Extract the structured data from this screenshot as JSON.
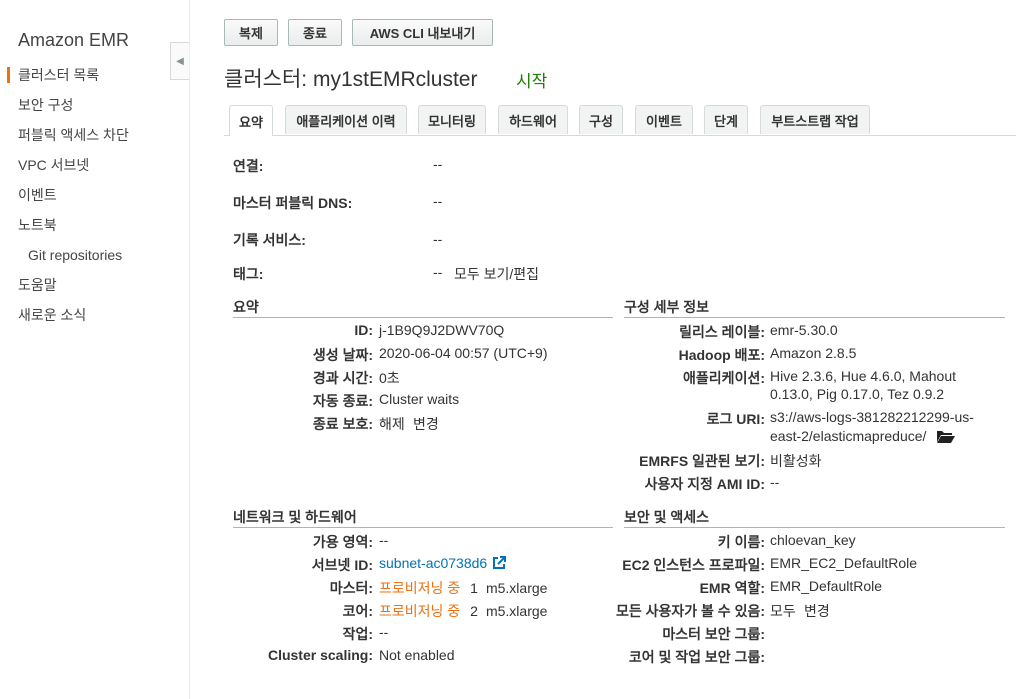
{
  "sidebar": {
    "title": "Amazon EMR",
    "items": [
      {
        "label": "클러스터 목록"
      },
      {
        "label": "보안 구성"
      },
      {
        "label": "퍼블릭 액세스 차단"
      },
      {
        "label": "VPC 서브넷"
      },
      {
        "label": "이벤트"
      },
      {
        "label": "노트북"
      },
      {
        "label": "Git repositories"
      },
      {
        "label": "도움말"
      },
      {
        "label": "새로운 소식"
      }
    ]
  },
  "toolbar": {
    "clone_label": "복제",
    "terminate_label": "종료",
    "cli_export_label": "AWS CLI 내보내기"
  },
  "header": {
    "title": "클러스터: my1stEMRcluster",
    "status": "시작"
  },
  "tabs": [
    "요약",
    "애플리케이션 이력",
    "모니터링",
    "하드웨어",
    "구성",
    "이벤트",
    "단계",
    "부트스트랩 작업"
  ],
  "connections": {
    "connect_label": "연결:",
    "connect_value": "--",
    "dns_label": "마스터 퍼블릭 DNS:",
    "dns_value": "--",
    "logging_label": "기록 서비스:",
    "logging_value": "--",
    "tags_label": "태그:",
    "tags_value": "--",
    "tags_link": "모두 보기/편집"
  },
  "summary": {
    "heading": "요약",
    "id_label": "ID:",
    "id_value": "j-1B9Q9J2DWV70Q",
    "created_label": "생성 날짜:",
    "created_value": "2020-06-04 00:57 (UTC+9)",
    "elapsed_label": "경과 시간:",
    "elapsed_value": "0초",
    "auto_term_label": "자동 종료:",
    "auto_term_value": "Cluster waits",
    "term_protect_label": "종료 보호:",
    "term_protect_value": "해제",
    "term_protect_link": "변경"
  },
  "config": {
    "heading": "구성 세부 정보",
    "release_label": "릴리스 레이블:",
    "release_value": "emr-5.30.0",
    "hadoop_label": "Hadoop 배포:",
    "hadoop_value": "Amazon 2.8.5",
    "apps_label": "애플리케이션:",
    "apps_value_1": "Hive 2.3.6, Hue 4.6.0, Mahout",
    "apps_value_2": "0.13.0, Pig 0.17.0, Tez 0.9.2",
    "log_label": "로그 URI:",
    "log_value_1": "s3://aws-logs-381282212299-us-",
    "log_value_2": "east-2/elasticmapreduce/",
    "emrfs_label": "EMRFS 일관된 보기:",
    "emrfs_value": "비활성화",
    "ami_label": "사용자 지정 AMI ID:",
    "ami_value": "--"
  },
  "network": {
    "heading": "네트워크 및 하드웨어",
    "az_label": "가용 영역:",
    "az_value": "--",
    "subnet_label": "서브넷 ID:",
    "subnet_value": "subnet-ac0738d6",
    "master_label": "마스터:",
    "master_status": "프로비저닝 중",
    "master_count": "1",
    "master_type": "m5.xlarge",
    "core_label": "코어:",
    "core_status": "프로비저닝 중",
    "core_count": "2",
    "core_type": "m5.xlarge",
    "task_label": "작업:",
    "task_value": "--",
    "scaling_label": "Cluster scaling:",
    "scaling_value": "Not enabled"
  },
  "security": {
    "heading": "보안 및 액세스",
    "key_label": "키 이름:",
    "key_value": "chloevan_key",
    "profile_label": "EC2 인스턴스 프로파일:",
    "profile_value": "EMR_EC2_DefaultRole",
    "role_label": "EMR 역할:",
    "role_value": "EMR_DefaultRole",
    "visible_label": "모든 사용자가 볼 수 있음:",
    "visible_value": "모두",
    "visible_link": "변경",
    "master_sg_label": "마스터 보안 그룹:",
    "core_sg_label": "코어 및 작업 보안 그룹:"
  },
  "colors": {
    "accent": "#ec7211",
    "link": "#0073bb",
    "status_green": "#1d8102"
  }
}
